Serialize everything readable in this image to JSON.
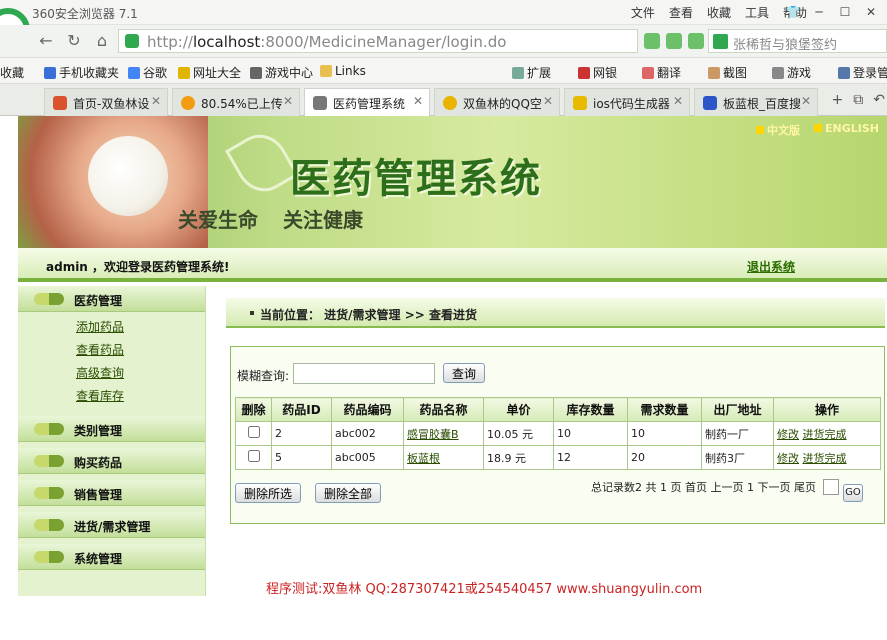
{
  "browser": {
    "title": "360安全浏览器 7.1",
    "menus": [
      "文件",
      "查看",
      "收藏",
      "工具",
      "帮助"
    ],
    "url_prefix": "http://",
    "url_host": "localhost",
    "url_rest": ":8000/MedicineManager/login.do",
    "search_text": "张稀哲与狼堡签约",
    "bookmarks": [
      "收藏",
      "手机收藏夹",
      "谷歌",
      "网址大全",
      "游戏中心",
      "Links",
      "扩展",
      "网银",
      "翻译",
      "截图",
      "游戏",
      "登录管家"
    ],
    "tabs": [
      {
        "label": "首页-双鱼林设",
        "active": false
      },
      {
        "label": "80.54%已上传",
        "active": false
      },
      {
        "label": "医药管理系统",
        "active": true
      },
      {
        "label": "双鱼林的QQ空",
        "active": false
      },
      {
        "label": "ios代码生成器",
        "active": false
      },
      {
        "label": "板蓝根_百度搜",
        "active": false
      }
    ]
  },
  "header": {
    "system_title": "医药管理系统",
    "slogan": "关爱生命 关注健康",
    "lang_cn": "中文版",
    "lang_en": "ENGLISH"
  },
  "welcome": {
    "message": "admin ，欢迎登录医药管理系统!",
    "logout": "退出系统"
  },
  "sidebar": {
    "sections": [
      {
        "title": "医药管理",
        "items": [
          "添加药品",
          "查看药品",
          "高级查询",
          "查看库存"
        ]
      },
      {
        "title": "类别管理",
        "items": []
      },
      {
        "title": "购买药品",
        "items": []
      },
      {
        "title": "销售管理",
        "items": []
      },
      {
        "title": "进货/需求管理",
        "items": []
      },
      {
        "title": "系统管理",
        "items": []
      }
    ]
  },
  "location": {
    "text": "当前位置： 进货/需求管理 >> 查看进货"
  },
  "search": {
    "label": "模糊查询:",
    "value": "",
    "button": "查询"
  },
  "table": {
    "headers": [
      "删除",
      "药品ID",
      "药品编码",
      "药品名称",
      "单价",
      "库存数量",
      "需求数量",
      "出厂地址",
      "操作"
    ],
    "rows": [
      {
        "id": "2",
        "code": "abc002",
        "name": "感冒胶囊B",
        "price": "10.05 元",
        "stock": "10",
        "demand": "10",
        "factory": "制药一厂",
        "op_edit": "修改",
        "op_done": "进货完成"
      },
      {
        "id": "5",
        "code": "abc005",
        "name": "板蓝根",
        "price": "18.9 元",
        "stock": "12",
        "demand": "20",
        "factory": "制药3厂",
        "op_edit": "修改",
        "op_done": "进货完成"
      }
    ]
  },
  "actions": {
    "delete_selected": "删除所选",
    "delete_all": "删除全部"
  },
  "pager": {
    "text": "总记录数2 共 1 页 首页 上一页 1 下一页 尾页",
    "go": "GO"
  },
  "footer": {
    "note": "程序测试:双鱼林 QQ:287307421或254540457 www.shuangyulin.com"
  }
}
